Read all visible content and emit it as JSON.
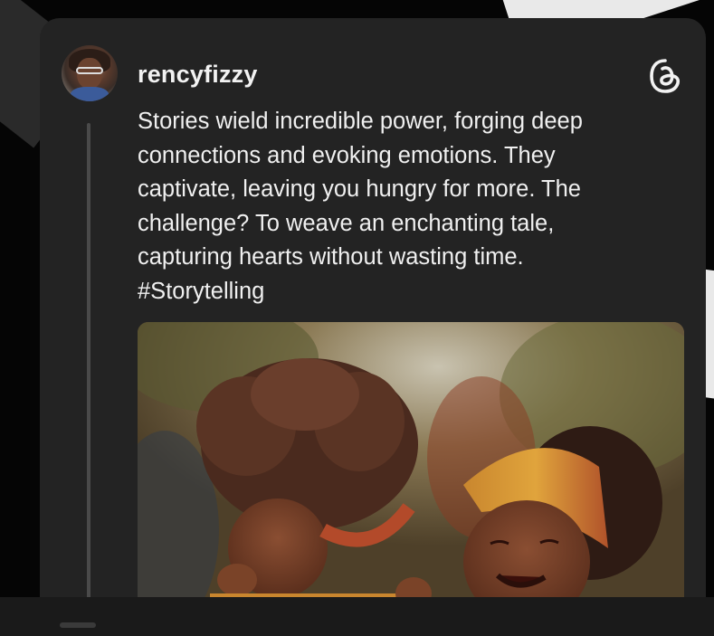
{
  "post": {
    "username": "rencyfizzy",
    "text": "Stories wield incredible power, forging deep\nconnections and evoking emotions. They\ncaptivate, leaving you hungry for more. The\nchallenge? To weave an enchanting tale,\ncapturing hearts without wasting time.\n#Storytelling",
    "platform_icon": "threads-icon",
    "avatar_icon": "profile-photo",
    "image": "illustration-two-girls-laughing"
  },
  "colors": {
    "card_bg": "#232323",
    "text": "#f0f0f0",
    "thread_line": "#4a4a4a"
  }
}
